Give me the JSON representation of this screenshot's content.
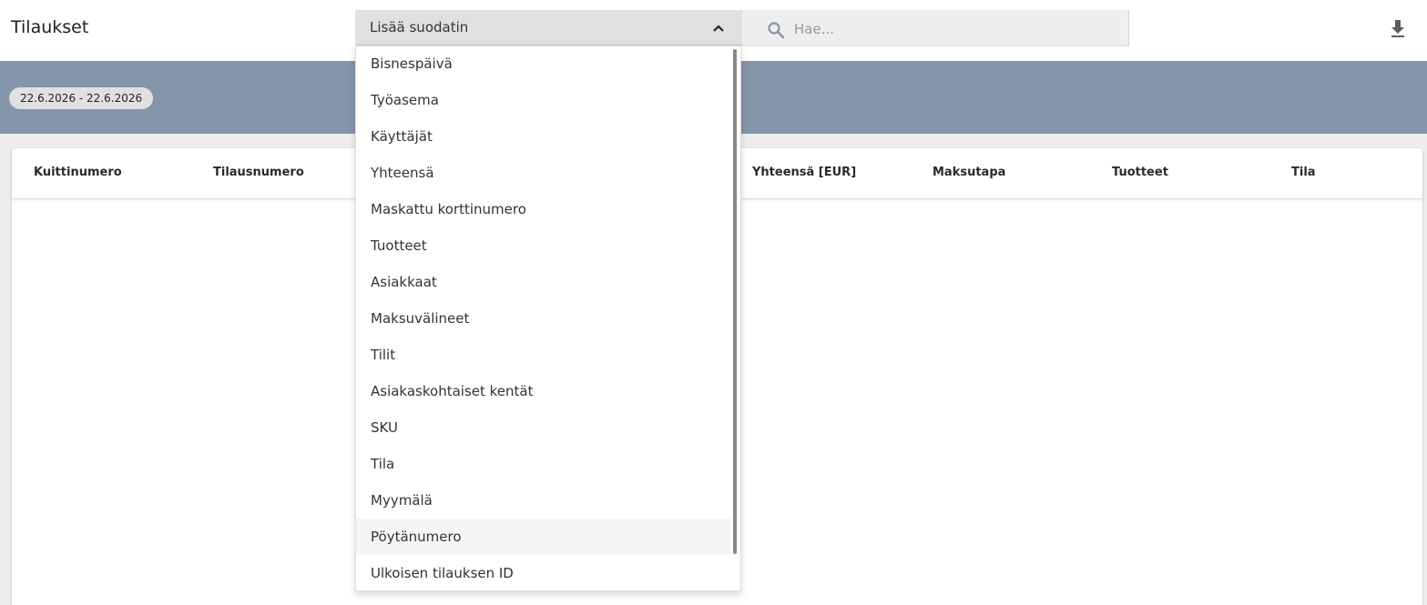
{
  "header": {
    "title": "Tilaukset",
    "filter_label": "Lisää suodatin",
    "search_placeholder": "Hae...",
    "icons": {
      "chevron": "chevron-up-icon",
      "search": "search-icon",
      "download": "download-icon"
    }
  },
  "date_range": "22.6.2026 - 22.6.2026",
  "table": {
    "columns": [
      "Kuittinumero",
      "Tilausnumero",
      "Yhteensä [EUR]",
      "Maksutapa",
      "Tuotteet",
      "Tila"
    ]
  },
  "filter_options": [
    "Bisnespäivä",
    "Työasema",
    "Käyttäjät",
    "Yhteensä",
    "Maskattu korttinumero",
    "Tuotteet",
    "Asiakkaat",
    "Maksuvälineet",
    "Tilit",
    "Asiakaskohtaiset kentät",
    "SKU",
    "Tila",
    "Myymälä",
    "Pöytänumero",
    "Ulkoisen tilauksen ID"
  ],
  "highlighted_option": "Pöytänumero",
  "colors": {
    "band": "#8595aa",
    "dropdown_header": "#e0e0e0",
    "highlight": "#f5f5f5"
  }
}
